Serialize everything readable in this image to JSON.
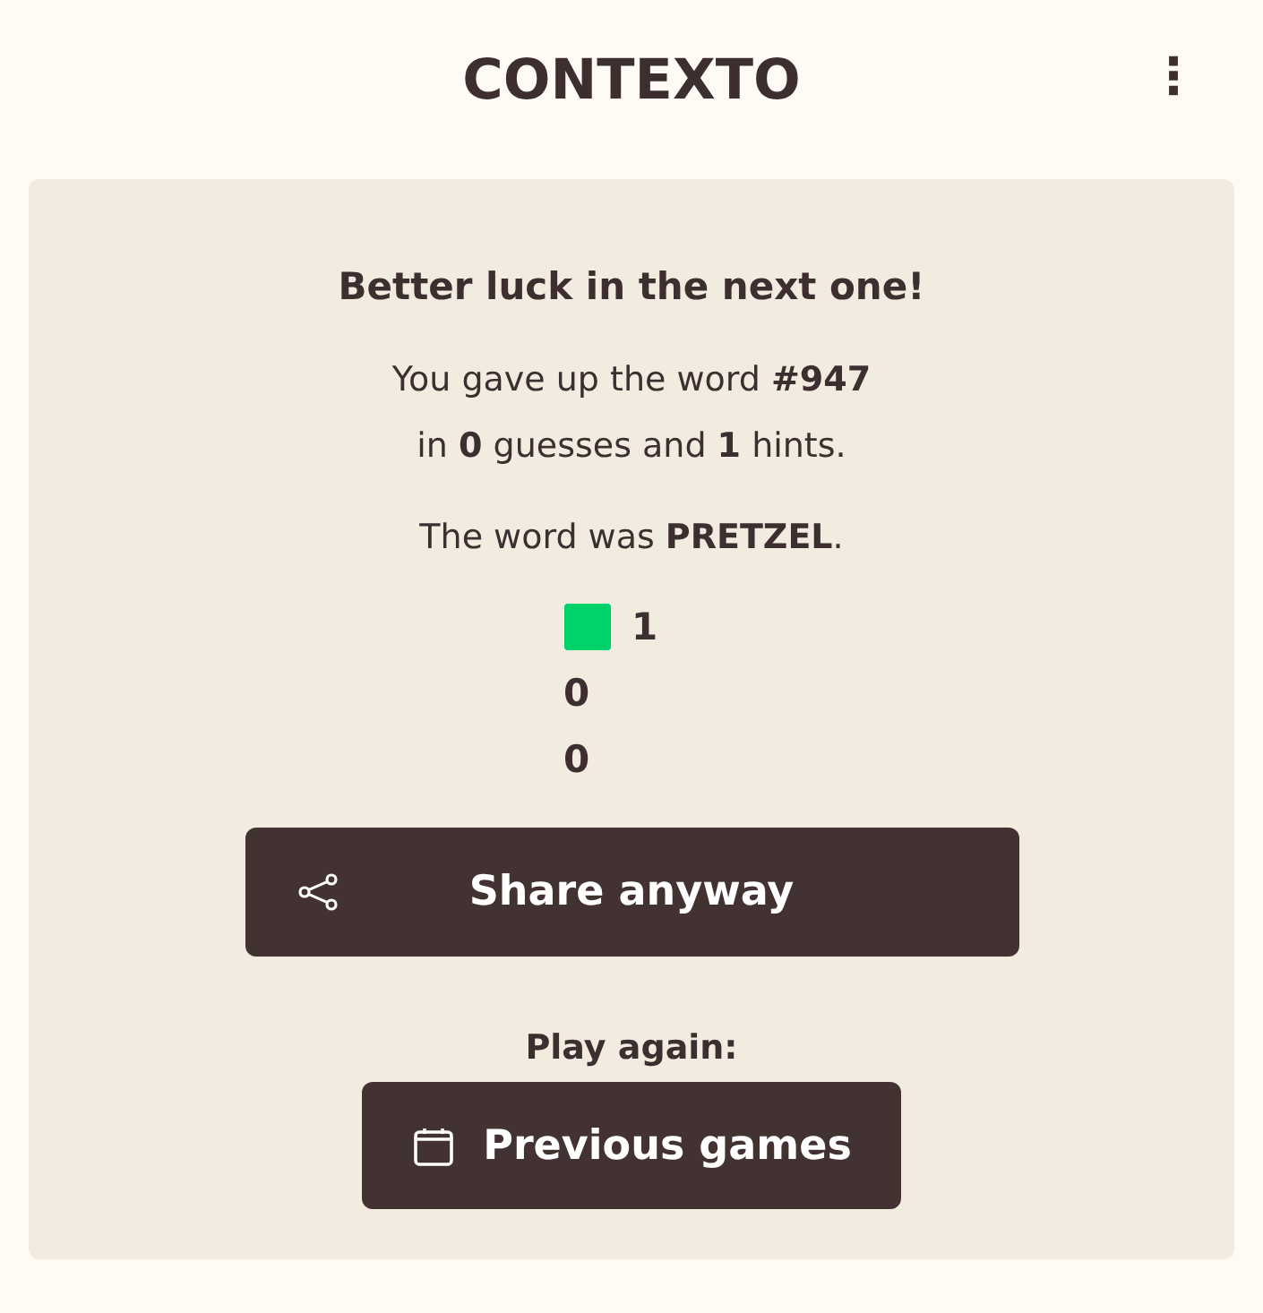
{
  "header": {
    "title": "CONTEXTO",
    "menu_icon": "⋮"
  },
  "result": {
    "heading": "Better luck in the next one!",
    "summary_lines": [
      "You gave up the word **#947**",
      "in **0** guesses and **1** hints."
    ],
    "answer": "The word was **PRETZEL**.",
    "stats": [
      {
        "count": "1",
        "color": "#00d26a"
      },
      {
        "count": "0"
      },
      {
        "count": "0"
      }
    ],
    "share_button": "Share anyway",
    "play_again": "Play again:",
    "previous_button": "Previous games"
  }
}
